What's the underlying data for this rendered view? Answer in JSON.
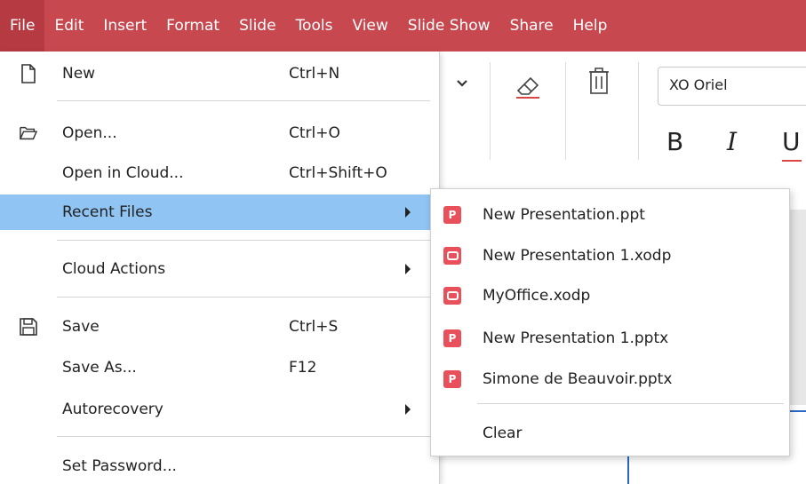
{
  "menubar": {
    "items": [
      "File",
      "Edit",
      "Insert",
      "Format",
      "Slide",
      "Tools",
      "View",
      "Slide Show",
      "Share",
      "Help"
    ]
  },
  "background": {
    "font_name": "XO Oriel",
    "bold_glyph": "B",
    "italic_glyph": "I",
    "underline_glyph": "U"
  },
  "file_menu": {
    "items": [
      {
        "label": "New",
        "shortcut": "Ctrl+N",
        "icon": "new-file-icon"
      },
      {
        "label": "Open...",
        "shortcut": "Ctrl+O",
        "icon": "folder-open-icon"
      },
      {
        "label": "Open in Cloud...",
        "shortcut": "Ctrl+Shift+O"
      },
      {
        "label": "Recent Files",
        "submenu": true,
        "highlighted": true
      },
      {
        "label": "Cloud Actions",
        "submenu": true
      },
      {
        "label": "Save",
        "shortcut": "Ctrl+S",
        "icon": "save-icon"
      },
      {
        "label": "Save As...",
        "shortcut": "F12"
      },
      {
        "label": "Autorecovery",
        "submenu": true
      },
      {
        "label": "Set Password..."
      }
    ]
  },
  "recent_files": {
    "items": [
      {
        "name": "New Presentation.ppt",
        "icon": "ppt",
        "badge": "P"
      },
      {
        "name": "New Presentation 1.xodp",
        "icon": "xodp",
        "badge": ""
      },
      {
        "name": "MyOffice.xodp",
        "icon": "xodp",
        "badge": ""
      },
      {
        "name": "New Presentation 1.pptx",
        "icon": "ppt",
        "badge": "P"
      },
      {
        "name": "Simone de Beauvoir.pptx",
        "icon": "ppt",
        "badge": "P"
      }
    ],
    "clear_label": "Clear"
  },
  "colors": {
    "menubar_bg": "#c8484f",
    "highlight": "#90c4f3",
    "file_icon_red": "#e8505b"
  }
}
